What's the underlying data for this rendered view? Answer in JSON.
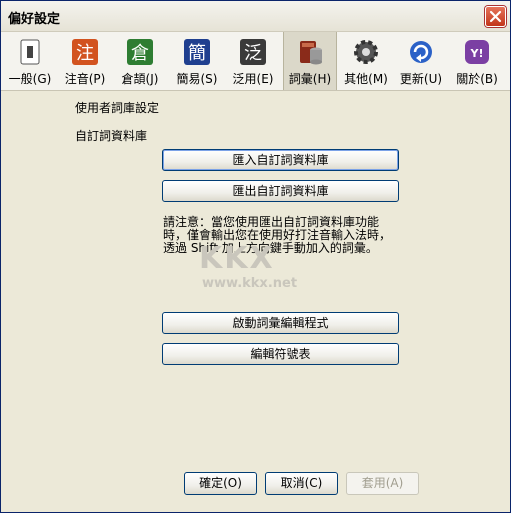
{
  "window": {
    "title": "偏好設定"
  },
  "toolbar": {
    "items": [
      {
        "label": "一般(G)",
        "icon": "general-icon"
      },
      {
        "label": "注音(P)",
        "icon": "zhuyin-icon",
        "glyph": "注"
      },
      {
        "label": "倉頡(J)",
        "icon": "cangjie-icon",
        "glyph": "倉"
      },
      {
        "label": "簡易(S)",
        "icon": "simplex-icon",
        "glyph": "簡"
      },
      {
        "label": "泛用(E)",
        "icon": "generic-icon",
        "glyph": "泛"
      },
      {
        "label": "詞彙(H)",
        "icon": "phrase-db-icon"
      },
      {
        "label": "其他(M)",
        "icon": "gear-icon"
      },
      {
        "label": "更新(U)",
        "icon": "update-icon"
      },
      {
        "label": "關於(B)",
        "icon": "about-icon",
        "glyph": "Y!"
      }
    ],
    "active_index": 5
  },
  "section": {
    "title": "使用者詞庫設定",
    "subtitle": "自訂詞資料庫",
    "import_button": "匯入自訂詞資料庫",
    "export_button": "匯出自訂詞資料庫",
    "note_lines": [
      "請注意：當您使用匯出自訂詞資料庫功能",
      "時，僅會輸出您在使用好打注音輸入法時，",
      "透過 Shift 加上方向鍵手動加入的詞彙。"
    ],
    "editor_button": "啟動詞彙編輯程式",
    "symbol_button": "編輯符號表"
  },
  "watermark": {
    "big": "KKX",
    "small": "www.kkx.net"
  },
  "footer": {
    "ok": "確定(O)",
    "cancel": "取消(C)",
    "apply": "套用(A)"
  },
  "colors": {
    "accent": "#003c74",
    "toolbar_bg": "#f4f3ee",
    "panel_bg": "#ece9d8",
    "close": "#c2351a"
  }
}
